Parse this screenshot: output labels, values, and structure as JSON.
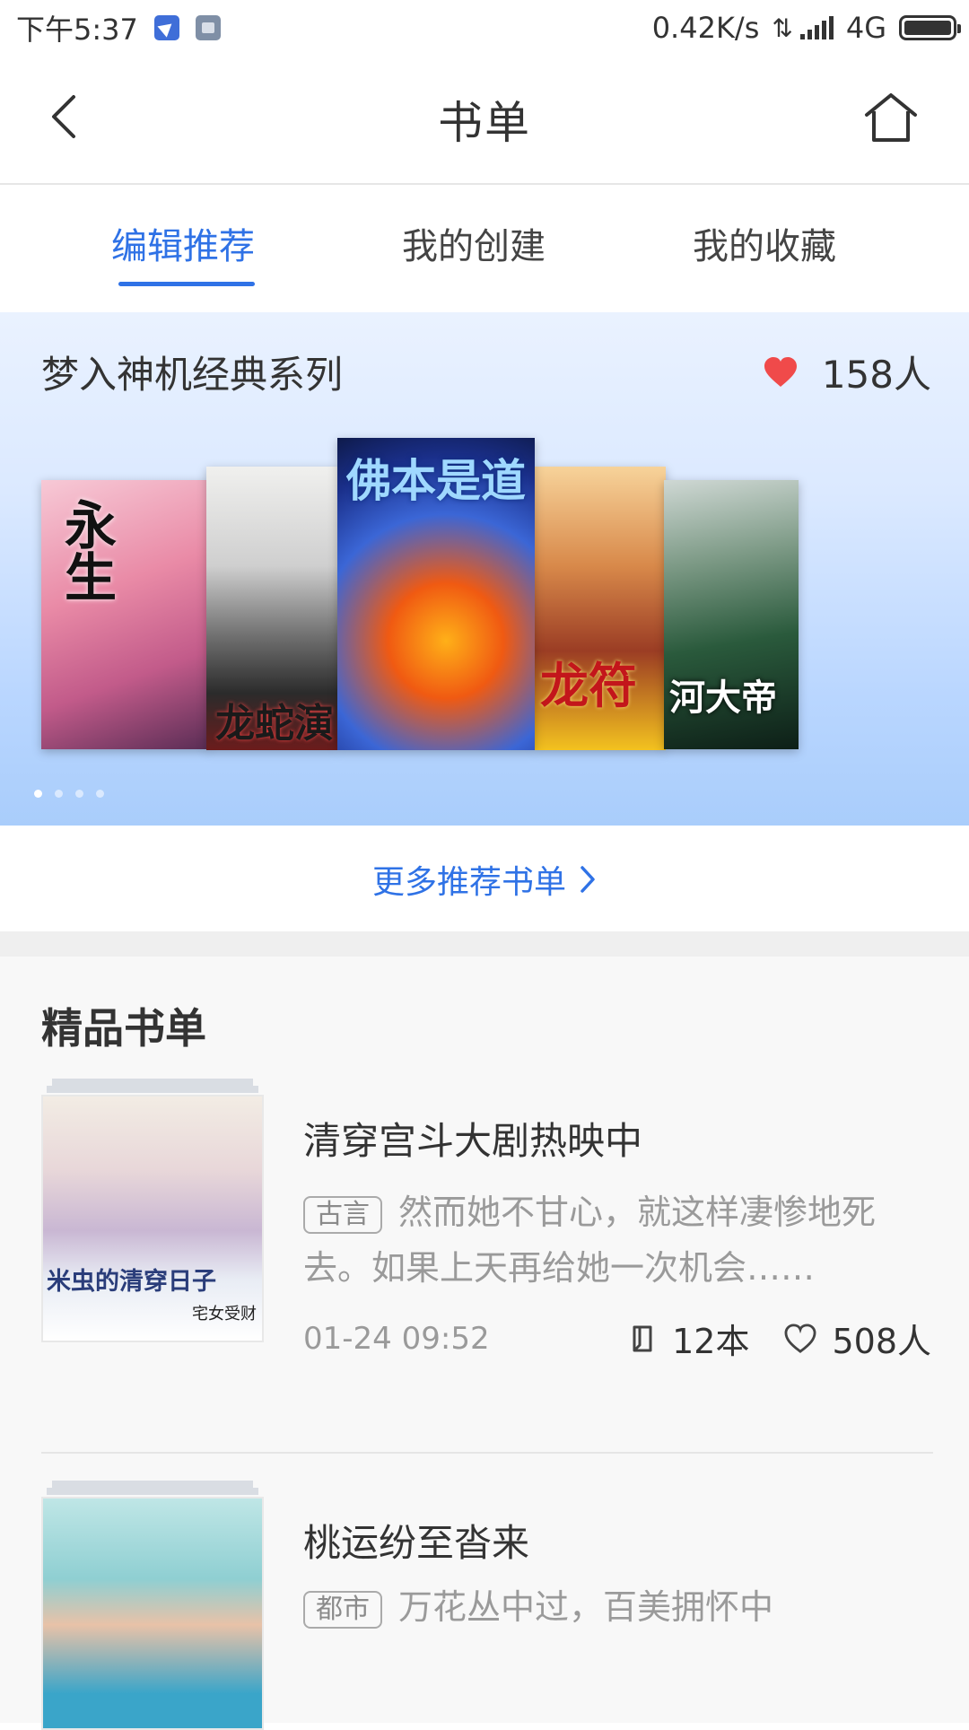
{
  "status_bar": {
    "time": "下午5:37",
    "network_speed": "0.42K/s",
    "network_type": "4G"
  },
  "header": {
    "title": "书单"
  },
  "tabs": [
    {
      "label": "编辑推荐"
    },
    {
      "label": "我的创建"
    },
    {
      "label": "我的收藏"
    }
  ],
  "banner": {
    "title": "梦入神机经典系列",
    "likes": "158人",
    "covers": [
      {
        "text": "永生"
      },
      {
        "text": "龙蛇演"
      },
      {
        "text": "佛本是道"
      },
      {
        "text": "龙符"
      },
      {
        "text": "河大帝"
      }
    ]
  },
  "more_link": "更多推荐书单",
  "section_title": "精品书单",
  "booklists": [
    {
      "title": "清穿宫斗大剧热映中",
      "tag": "古言",
      "description": "然而她不甘心，就这样凄惨地死去。如果上天再给她一次机会……",
      "date": "01-24 09:52",
      "books": "12本",
      "likes": "508人",
      "cover_text": "米虫的清穿日子",
      "cover_author": "宅女受财"
    },
    {
      "title": "桃运纷至沓来",
      "tag": "都市",
      "description": "万花丛中过，百美拥怀中"
    }
  ],
  "colors": {
    "accent": "#2f72e6",
    "heart": "#f04a4a"
  }
}
